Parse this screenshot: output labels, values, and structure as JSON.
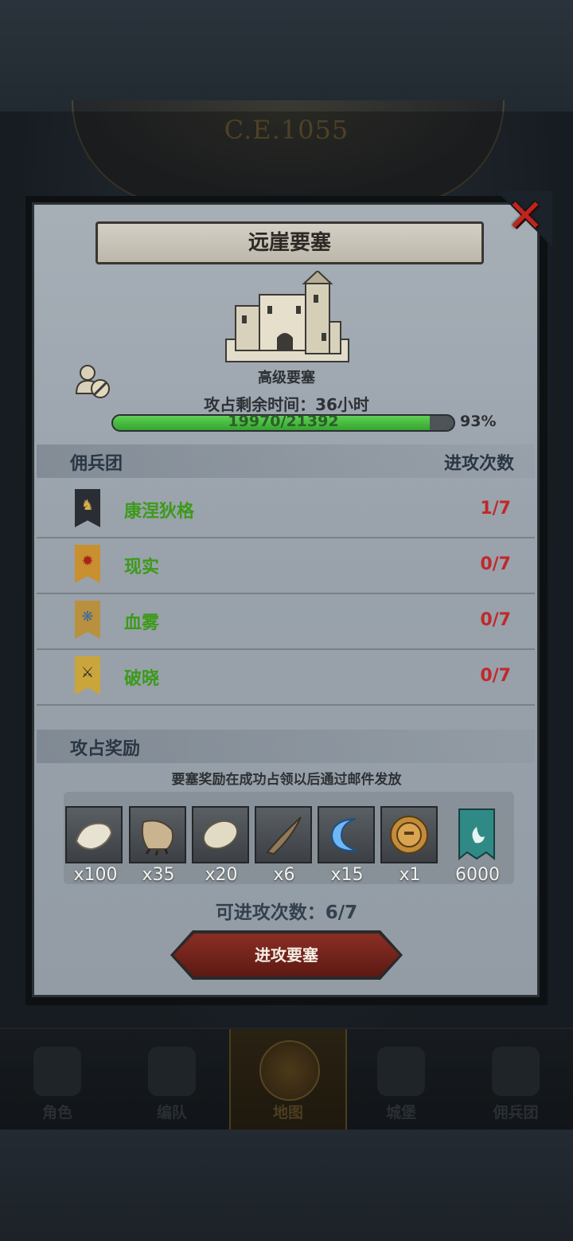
{
  "background": {
    "era": "C.E.1055"
  },
  "dialog": {
    "title": "远崖要塞",
    "fortress_tier": "高级要塞",
    "time_remaining": "攻占剩余时间：36小时",
    "progress": {
      "current": 19970,
      "max": 21392,
      "text": "19970/21392",
      "percent_label": "93%",
      "fraction": 0.93
    },
    "mercenary_header": "佣兵团",
    "attack_count_header": "进攻次数",
    "mercenaries": [
      {
        "name": "康涅狄格",
        "attacks": "1/7",
        "banner_color": "#2a2d33",
        "glyph": "♞",
        "glyph_color": "#d6b24a"
      },
      {
        "name": "现实",
        "attacks": "0/7",
        "banner_color": "#c8902e",
        "glyph": "✹",
        "glyph_color": "#a8221c"
      },
      {
        "name": "血雾",
        "attacks": "0/7",
        "banner_color": "#b9913e",
        "glyph": "❋",
        "glyph_color": "#3d6aa0"
      },
      {
        "name": "破晓",
        "attacks": "0/7",
        "banner_color": "#c9a53b",
        "glyph": "⚔",
        "glyph_color": "#2a2520"
      }
    ],
    "reward_header": "攻占奖励",
    "reward_note": "要塞奖励在成功占领以后通过邮件发放",
    "rewards": [
      {
        "icon": "fur-pelt-icon",
        "qty": "x100",
        "color": "#e8e2d2"
      },
      {
        "icon": "beast-claw-icon",
        "qty": "x35",
        "color": "#c9b48f"
      },
      {
        "icon": "scale-hide-icon",
        "qty": "x20",
        "color": "#e1dbc6"
      },
      {
        "icon": "horn-icon",
        "qty": "x6",
        "color": "#8f7a5c"
      },
      {
        "icon": "crescent-rune-icon",
        "qty": "x15",
        "color": "#6fb7f2"
      },
      {
        "icon": "knight-medal-icon",
        "qty": "x1",
        "color": "#c28c3a"
      },
      {
        "icon": "guild-flag-icon",
        "qty": "6000",
        "color": "#2f8a86"
      }
    ],
    "attempts_label": "可进攻次数：6/7",
    "attack_button": "进攻要塞"
  },
  "bottom_nav": [
    {
      "label": "角色",
      "icon": "character-icon",
      "active": false
    },
    {
      "label": "编队",
      "icon": "formation-icon",
      "active": false
    },
    {
      "label": "地图",
      "icon": "map-icon",
      "active": true
    },
    {
      "label": "城堡",
      "icon": "castle-icon",
      "active": false
    },
    {
      "label": "佣兵团",
      "icon": "mercenary-icon",
      "active": false
    }
  ]
}
